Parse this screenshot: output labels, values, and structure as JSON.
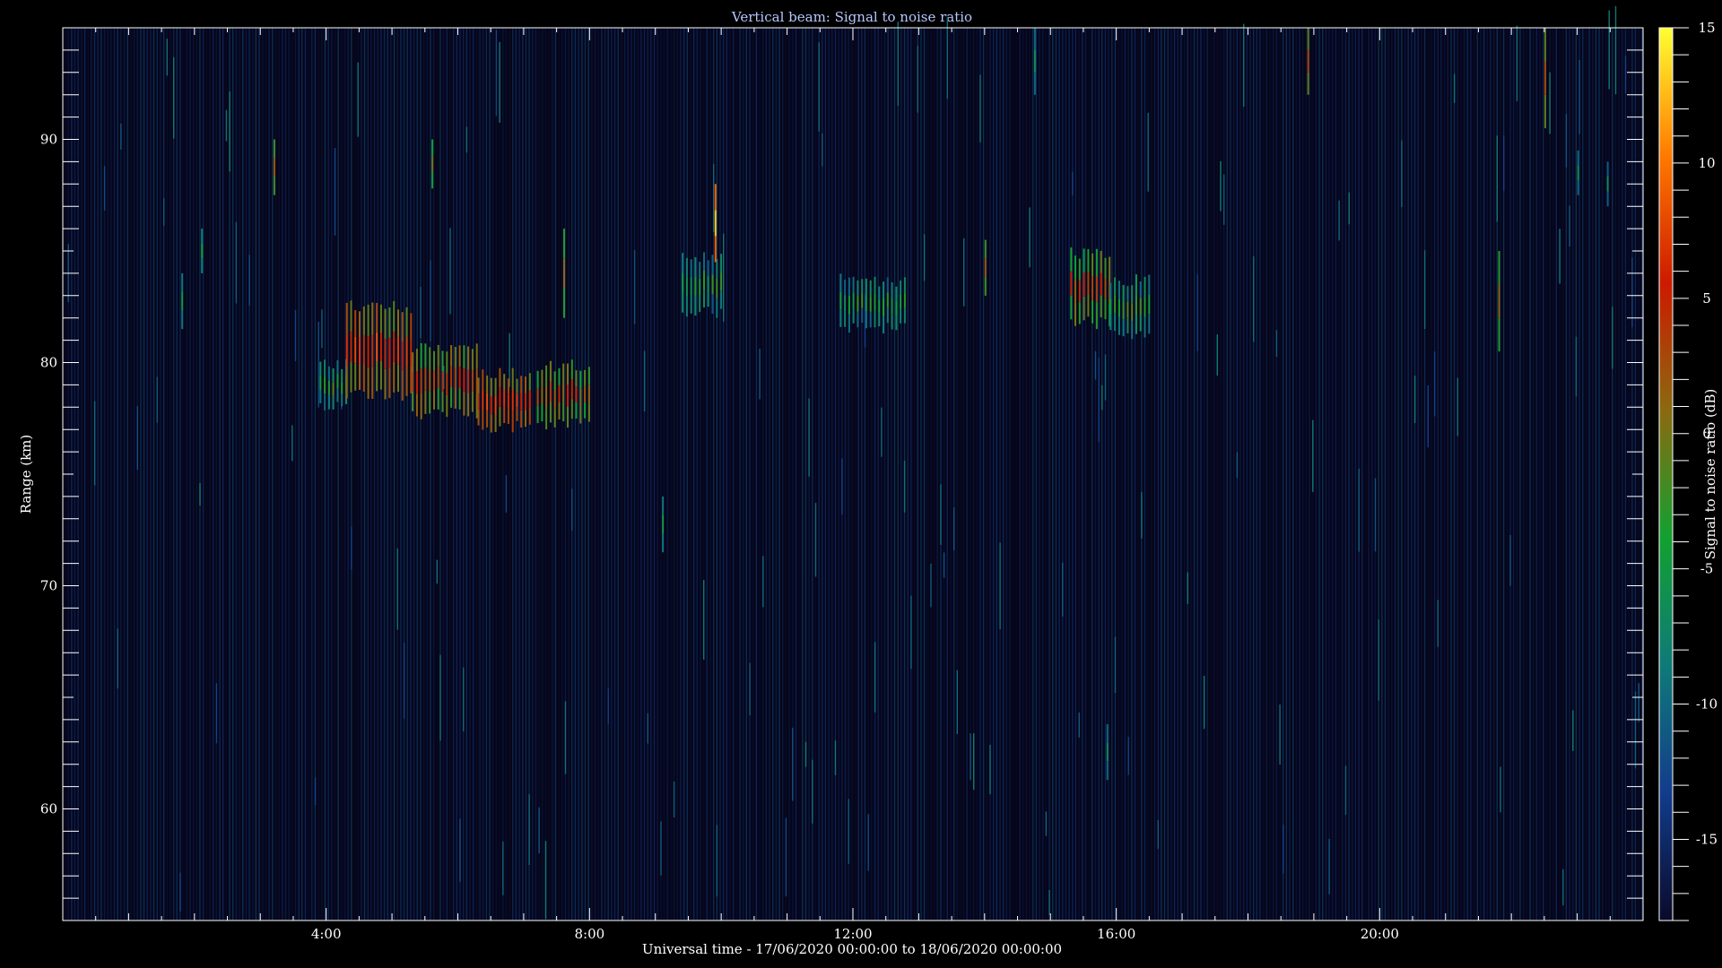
{
  "chart_data": {
    "type": "heatmap",
    "title": "Vertical beam: Signal to noise ratio",
    "xlabel": "Universal time - 17/06/2020 00:00:00 to 18/06/2020 00:00:00",
    "ylabel": "Range (km)",
    "colorbar_label": "Signal to noise ratio (dB)",
    "x_unit": "hours UT",
    "xlim": [
      0,
      24
    ],
    "ylim": [
      55,
      95
    ],
    "clim": [
      -18,
      15
    ],
    "x_ticks": [
      {
        "value": 4,
        "label": "4:00"
      },
      {
        "value": 8,
        "label": "8:00"
      },
      {
        "value": 12,
        "label": "12:00"
      },
      {
        "value": 16,
        "label": "16:00"
      },
      {
        "value": 20,
        "label": "20:00"
      }
    ],
    "y_ticks": [
      {
        "value": 60,
        "label": "60"
      },
      {
        "value": 70,
        "label": "70"
      },
      {
        "value": 80,
        "label": "80"
      },
      {
        "value": 90,
        "label": "90"
      }
    ],
    "colorbar_ticks": [
      {
        "value": 15,
        "label": "15"
      },
      {
        "value": 10,
        "label": "10"
      },
      {
        "value": 5,
        "label": "5"
      },
      {
        "value": 0,
        "label": "0"
      },
      {
        "value": -5,
        "label": "-5"
      },
      {
        "value": -10,
        "label": "-10"
      },
      {
        "value": -15,
        "label": "-15"
      }
    ],
    "colormap": [
      "#0a0a2a",
      "#123c8c",
      "#0f7a78",
      "#12a030",
      "#8a6a10",
      "#cc1a00",
      "#ff7a00",
      "#ffff33"
    ],
    "echo_regions": [
      {
        "t_start": 3.9,
        "t_end": 4.3,
        "range_min": 77.8,
        "range_max": 80.2,
        "snr_db": -3
      },
      {
        "t_start": 4.3,
        "t_end": 5.3,
        "range_min": 78.2,
        "range_max": 82.8,
        "snr_db": 6
      },
      {
        "t_start": 5.3,
        "t_end": 6.3,
        "range_min": 77.4,
        "range_max": 81.0,
        "snr_db": 4
      },
      {
        "t_start": 6.3,
        "t_end": 7.1,
        "range_min": 76.8,
        "range_max": 79.8,
        "snr_db": 6
      },
      {
        "t_start": 7.2,
        "t_end": 8.0,
        "range_min": 77.0,
        "range_max": 80.2,
        "snr_db": 3
      },
      {
        "t_start": 9.4,
        "t_end": 10.0,
        "range_min": 82.0,
        "range_max": 85.0,
        "snr_db": -4
      },
      {
        "t_start": 11.8,
        "t_end": 12.8,
        "range_min": 81.3,
        "range_max": 84.0,
        "snr_db": -4
      },
      {
        "t_start": 15.3,
        "t_end": 15.9,
        "range_min": 81.5,
        "range_max": 85.2,
        "snr_db": 3
      },
      {
        "t_start": 15.9,
        "t_end": 16.5,
        "range_min": 81.0,
        "range_max": 84.0,
        "snr_db": -3
      }
    ],
    "isolated_echoes": [
      {
        "t": 9.9,
        "range_min": 84.5,
        "range_max": 88.0,
        "snr_db": 13
      },
      {
        "t": 3.2,
        "range_min": 87.5,
        "range_max": 90.0,
        "snr_db": 2
      },
      {
        "t": 5.6,
        "range_min": 87.8,
        "range_max": 90.0,
        "snr_db": 0
      },
      {
        "t": 7.6,
        "range_min": 82.0,
        "range_max": 86.0,
        "snr_db": 1
      },
      {
        "t": 14.0,
        "range_min": 83.0,
        "range_max": 85.5,
        "snr_db": 2
      },
      {
        "t": 18.9,
        "range_min": 92.0,
        "range_max": 95.0,
        "snr_db": 3
      },
      {
        "t": 22.5,
        "range_min": 90.5,
        "range_max": 95.0,
        "snr_db": 3
      },
      {
        "t": 21.8,
        "range_min": 80.5,
        "range_max": 85.0,
        "snr_db": 1
      },
      {
        "t": 2.1,
        "range_min": 84.0,
        "range_max": 86.0,
        "snr_db": -4
      },
      {
        "t": 1.8,
        "range_min": 81.5,
        "range_max": 84.0,
        "snr_db": -5
      },
      {
        "t": 9.1,
        "range_min": 71.5,
        "range_max": 74.0,
        "snr_db": -5
      },
      {
        "t": 15.85,
        "range_min": 61.3,
        "range_max": 63.8,
        "snr_db": -6
      },
      {
        "t": 14.75,
        "range_min": 92.0,
        "range_max": 95.0,
        "snr_db": -6
      },
      {
        "t": 23.0,
        "range_min": 87.5,
        "range_max": 89.5,
        "snr_db": -6
      },
      {
        "t": 23.45,
        "range_min": 87.0,
        "range_max": 89.0,
        "snr_db": -7
      }
    ]
  }
}
